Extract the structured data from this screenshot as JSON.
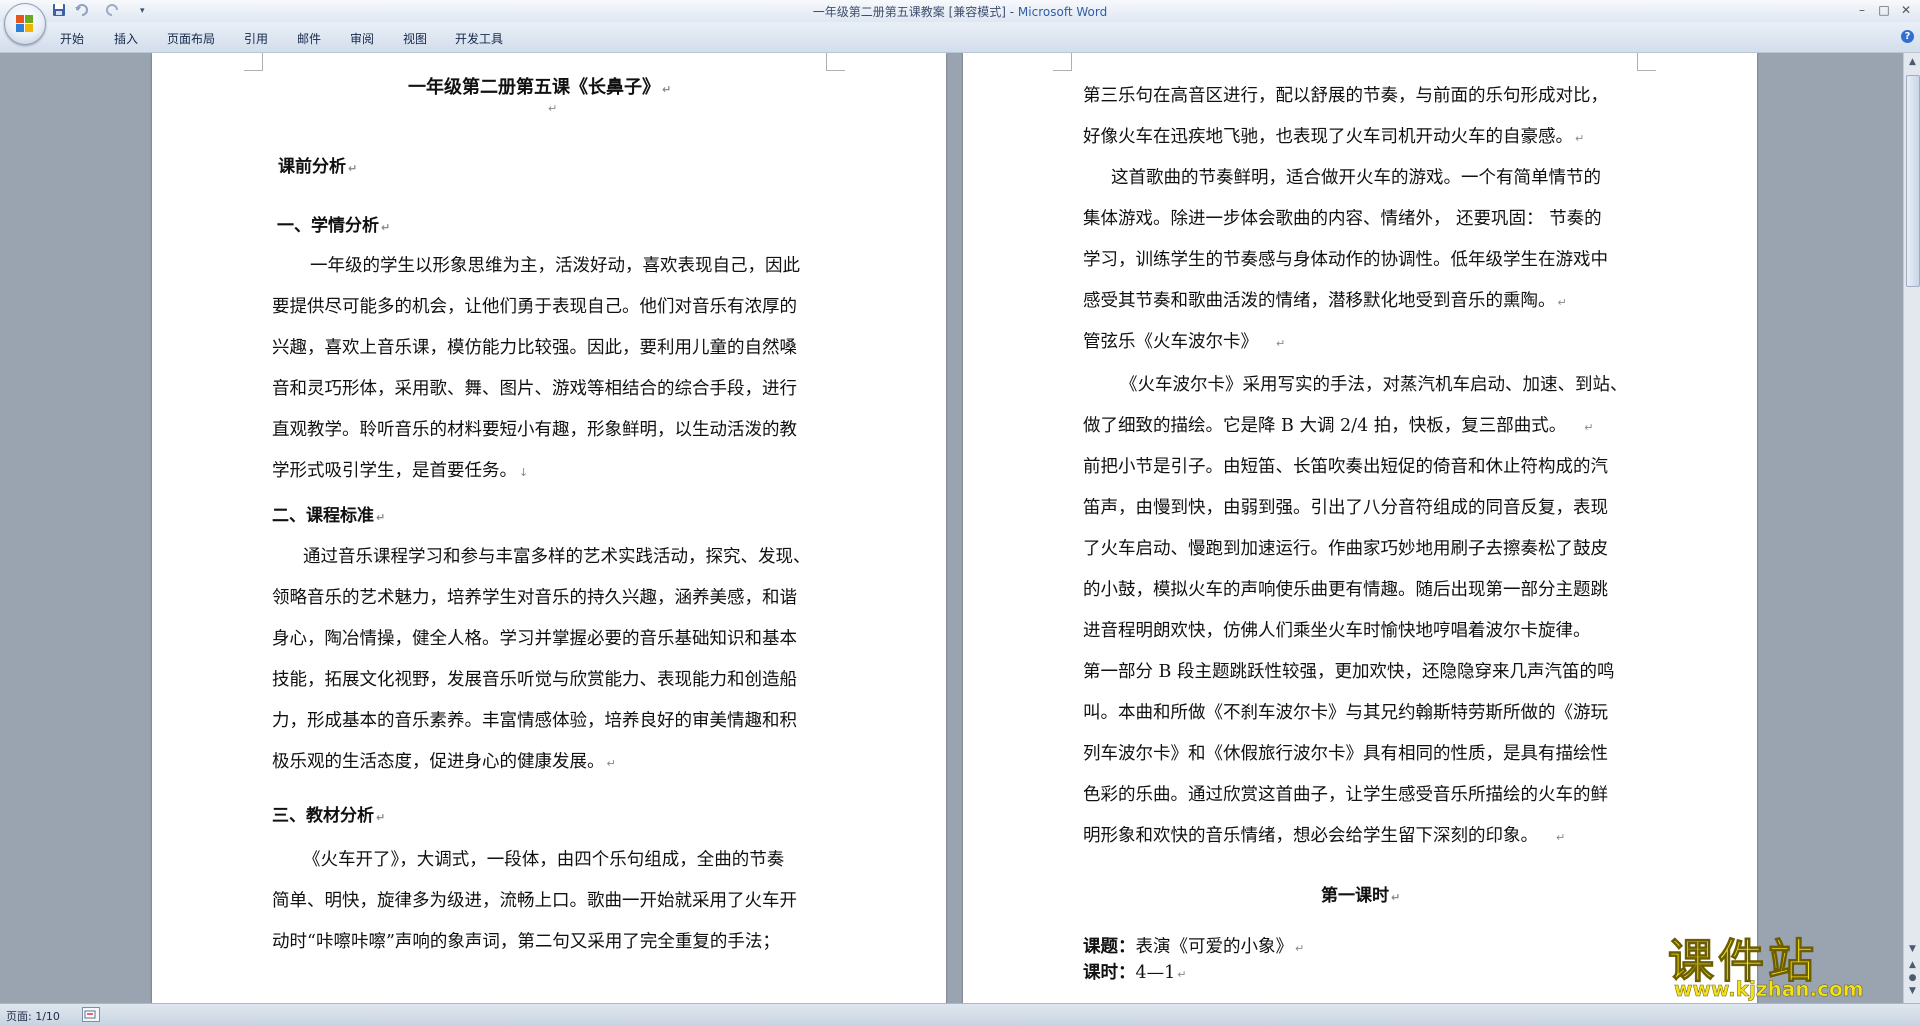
{
  "window": {
    "title_doc": "一年级第二册第五课教案 [兼容模式] - ",
    "title_app": "Microsoft Word",
    "minimize": "–",
    "maximize": "□",
    "close": "✕"
  },
  "ribbon": {
    "tabs": [
      "开始",
      "插入",
      "页面布局",
      "引用",
      "邮件",
      "审阅",
      "视图",
      "开发工具"
    ],
    "help": "?"
  },
  "page_left": {
    "title": "一年级第二册第五课《长鼻子》",
    "section_heading": "课前分析",
    "h1": "一、学情分析",
    "p1": [
      "一年级的学生以形象思维为主，活泼好动，喜欢表现自己，因此",
      "要提供尽可能多的机会，让他们勇于表现自己。他们对音乐有浓厚的",
      "兴趣，喜欢上音乐课，模仿能力比较强。因此，要利用儿童的自然嗓",
      "音和灵巧形体，采用歌、舞、图片、游戏等相结合的综合手段，进行",
      "直观教学。聆听音乐的材料要短小有趣，形象鲜明，以生动活泼的教",
      "学形式吸引学生，是首要任务。"
    ],
    "h2": "二、课程标准",
    "p2": [
      "通过音乐课程学习和参与丰富多样的艺术实践活动，探究、发现、",
      "领略音乐的艺术魅力，培养学生对音乐的持久兴趣，涵养美感，和谐",
      "身心，陶冶情操，健全人格。学习并掌握必要的音乐基础知识和基本",
      "技能，拓展文化视野，发展音乐听觉与欣赏能力、表现能力和创造船",
      "力，形成基本的音乐素养。丰富情感体验，培养良好的审美情趣和积",
      "极乐观的生活态度，促进身心的健康发展。"
    ],
    "h3": "三、教材分析",
    "p3": [
      "《火车开了》，大调式，一段体，由四个乐句组成，全曲的节奏",
      "简单、明快，旋律多为级进，流畅上口。歌曲一开始就采用了火车开",
      "动时“咔嚓咔嚓”声响的象声词，第二句又采用了完全重复的手法；"
    ]
  },
  "page_right": {
    "p1": [
      "第三乐句在高音区进行，配以舒展的节奏，与前面的乐句形成对比，",
      "好像火车在迅疾地飞驰，也表现了火车司机开动火车的自豪感。"
    ],
    "p2": [
      "这首歌曲的节奏鲜明，适合做开火车的游戏。一个有简单情节的",
      "集体游戏。除进一步体会歌曲的内容、情绪外，  还要巩固：  节奏的",
      "学习，训练学生的节奏感与身体动作的协调性。低年级学生在游戏中",
      "感受其节奏和歌曲活泼的情绪，潜移默化地受到音乐的熏陶。"
    ],
    "subhead": "管弦乐《火车波尔卡》",
    "p3": [
      "《火车波尔卡》采用写实的手法，对蒸汽机车启动、加速、到站、",
      "做了细致的描绘。它是降 B 大调 2/4 拍，快板，复三部曲式。",
      "前把小节是引子。由短笛、长笛吹奏出短促的倚音和休止符构成的汽",
      "笛声，由慢到快，由弱到强。引出了八分音符组成的同音反复，表现",
      "了火车启动、慢跑到加速运行。作曲家巧妙地用刷子去擦奏松了鼓皮",
      "的小鼓，模拟火车的声响使乐曲更有情趣。随后出现第一部分主题跳",
      "进音程明朗欢快，仿佛人们乘坐火车时愉快地哼唱着波尔卡旋律。",
      "第一部分 B 段主题跳跃性较强，更加欢快，还隐隐穿来几声汽笛的鸣",
      "叫。本曲和所做《不刹车波尔卡》与其兄约翰斯特劳斯所做的《游玩",
      "列车波尔卡》和《休假旅行波尔卡》具有相同的性质，是具有描绘性",
      "色彩的乐曲。通过欣赏这首曲子，让学生感受音乐所描绘的火车的鲜",
      "明形象和欢快的音乐情绪，想必会给学生留下深刻的印象。"
    ],
    "lesson_heading": "第一课时",
    "topic_label": "课题：",
    "topic_value": "表演《可爱的小象》",
    "period_label": "课时：",
    "period_value": "4—1"
  },
  "status": {
    "page": "页面: 1/10"
  },
  "watermark": {
    "main": "课件站",
    "url": "www.kjzhan.com"
  },
  "marks": {
    "para": "↵",
    "soft": "↓"
  }
}
